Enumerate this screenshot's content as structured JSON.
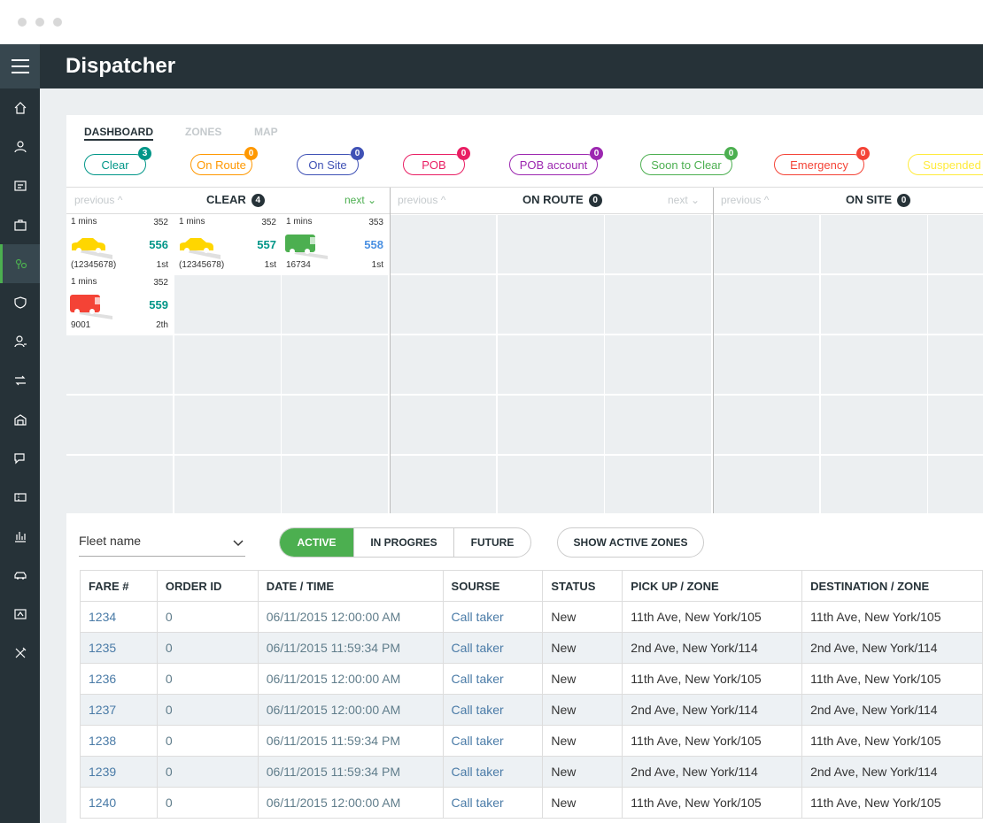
{
  "app": {
    "title": "Dispatcher"
  },
  "tabs": [
    "DASHBOARD",
    "ZONES",
    "MAP"
  ],
  "status_pills": [
    {
      "label": "Clear",
      "count": "3",
      "color": "#009688"
    },
    {
      "label": "On Route",
      "count": "0",
      "color": "#ff9800"
    },
    {
      "label": "On Site",
      "count": "0",
      "color": "#3f51b5"
    },
    {
      "label": "POB",
      "count": "0",
      "color": "#e91e63"
    },
    {
      "label": "POB account",
      "count": "0",
      "color": "#9c27b0"
    },
    {
      "label": "Soon to Clear",
      "count": "0",
      "color": "#4caf50"
    },
    {
      "label": "Emergency",
      "count": "0",
      "color": "#f44336"
    },
    {
      "label": "Suspended",
      "count": "",
      "color": "#ffeb3b"
    }
  ],
  "columns": [
    {
      "title": "CLEAR",
      "count": "4",
      "previous": "previous ^",
      "next": "next ⌄"
    },
    {
      "title": "ON ROUTE",
      "count": "0",
      "previous": "previous ^",
      "next": "next ⌄"
    },
    {
      "title": "ON SITE",
      "count": "0",
      "previous": "previous ^",
      "next": ""
    }
  ],
  "vehicles": [
    {
      "time": "1 mins",
      "zone": "352",
      "number": "556",
      "bottom_left": "(12345678)",
      "bottom_right": "1st",
      "type": "car",
      "color": "#ffd600"
    },
    {
      "time": "1 mins",
      "zone": "352",
      "number": "557",
      "bottom_left": "(12345678)",
      "bottom_right": "1st",
      "type": "car",
      "color": "#ffd600"
    },
    {
      "time": "1 mins",
      "zone": "353",
      "number": "558",
      "bottom_left": "16734",
      "bottom_right": "1st",
      "type": "van",
      "color": "#4caf50"
    },
    {
      "time": "1 mins",
      "zone": "352",
      "number": "559",
      "bottom_left": "9001",
      "bottom_right": "2th",
      "type": "van",
      "color": "#f44336"
    }
  ],
  "controls": {
    "fleet_name": "Fleet name",
    "segments": [
      "ACTIVE",
      "IN PROGRES",
      "FUTURE"
    ],
    "show_zones": "SHOW ACTIVE ZONES"
  },
  "table": {
    "headers": [
      "FARE #",
      "ORDER ID",
      "DATE / TIME",
      "SOURSE",
      "STATUS",
      "PICK UP / ZONE",
      "DESTINATION / ZONE"
    ],
    "rows": [
      [
        "1234",
        "0",
        "06/11/2015 12:00:00 AM",
        "Call taker",
        "New",
        "11th Ave, New York/105",
        "11th Ave, New York/105"
      ],
      [
        "1235",
        "0",
        "06/11/2015 11:59:34 PM",
        "Call taker",
        "New",
        "2nd Ave, New York/114",
        "2nd Ave, New York/114"
      ],
      [
        "1236",
        "0",
        "06/11/2015 12:00:00 AM",
        "Call taker",
        "New",
        "11th Ave, New York/105",
        "11th Ave, New York/105"
      ],
      [
        "1237",
        "0",
        "06/11/2015 12:00:00 AM",
        "Call taker",
        "New",
        "2nd Ave, New York/114",
        "2nd Ave, New York/114"
      ],
      [
        "1238",
        "0",
        "06/11/2015 11:59:34 PM",
        "Call taker",
        "New",
        "11th Ave, New York/105",
        "11th Ave, New York/105"
      ],
      [
        "1239",
        "0",
        "06/11/2015 11:59:34 PM",
        "Call taker",
        "New",
        "2nd Ave, New York/114",
        "2nd Ave, New York/114"
      ],
      [
        "1240",
        "0",
        "06/11/2015 12:00:00 AM",
        "Call taker",
        "New",
        "11th Ave, New York/105",
        "11th Ave, New York/105"
      ]
    ]
  },
  "sidebar_icons": [
    "home-icon",
    "user-icon",
    "report-icon",
    "briefcase-icon",
    "dispatch-icon",
    "shield-icon",
    "driver-icon",
    "routes-icon",
    "garage-icon",
    "chat-icon",
    "tickets-icon",
    "stats-icon",
    "car-icon",
    "billing-icon",
    "tools-icon"
  ],
  "sidebar_active": "dispatch-icon"
}
